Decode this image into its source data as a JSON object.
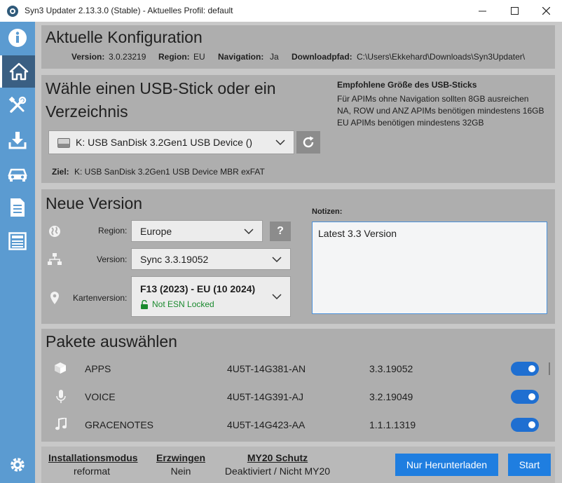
{
  "window": {
    "title": "Syn3 Updater 2.13.3.0 (Stable) - Aktuelles Profil: default",
    "minimize": "—",
    "maximize": "☐",
    "close": "✕"
  },
  "sidebar": {
    "items": [
      {
        "name": "info",
        "icon": "info-icon"
      },
      {
        "name": "home",
        "icon": "home-icon",
        "active": true
      },
      {
        "name": "tools",
        "icon": "tools-icon"
      },
      {
        "name": "download",
        "icon": "download-icon"
      },
      {
        "name": "car",
        "icon": "car-icon"
      },
      {
        "name": "log",
        "icon": "document-icon"
      },
      {
        "name": "news",
        "icon": "news-icon"
      },
      {
        "name": "settings",
        "icon": "gear-icon"
      }
    ]
  },
  "config": {
    "heading": "Aktuelle Konfiguration",
    "version_label": "Version:",
    "version_value": "3.0.23219",
    "region_label": "Region:",
    "region_value": "EU",
    "nav_label": "Navigation:",
    "nav_value": "Ja",
    "path_label": "Downloadpfad:",
    "path_value": "C:\\Users\\Ekkehard\\Downloads\\Syn3Updater\\"
  },
  "usb": {
    "heading_line1": "Wähle einen USB-Stick oder ein",
    "heading_line2": "Verzeichnis",
    "selected": "K:  USB  SanDisk 3.2Gen1 USB Device ()",
    "target_label": "Ziel:",
    "target_value": "K:  USB  SanDisk 3.2Gen1 USB Device  MBR exFAT",
    "recommend_title": "Empfohlene Größe des USB-Sticks",
    "recommend_lines": [
      "Für APIMs ohne Navigation sollten 8GB ausreichen",
      "NA, ROW und ANZ APIMs benötigen mindestens 16GB",
      "EU APIMs benötigen mindestens 32GB"
    ]
  },
  "new_version": {
    "heading": "Neue Version",
    "region_label": "Region:",
    "region_value": "Europe",
    "help_label": "?",
    "version_label": "Version:",
    "version_value": "Sync 3.3.19052",
    "map_label": "Kartenversion:",
    "map_value": "F13 (2023) - EU (10 2024)",
    "map_status": "Not ESN Locked",
    "notes_label": "Notizen:",
    "notes_value": "Latest 3.3 Version"
  },
  "packages": {
    "heading": "Pakete auswählen",
    "items": [
      {
        "name": "APPS",
        "part": "4U5T-14G381-AN",
        "version": "3.3.19052",
        "enabled": true,
        "icon": "package-icon"
      },
      {
        "name": "VOICE",
        "part": "4U5T-14G391-AJ",
        "version": "3.2.19049",
        "enabled": true,
        "icon": "microphone-icon"
      },
      {
        "name": "GRACENOTES",
        "part": "4U5T-14G423-AA",
        "version": "1.1.1.1319",
        "enabled": true,
        "icon": "music-note-icon"
      }
    ]
  },
  "footer": {
    "install_mode_label": "Installationsmodus",
    "install_mode_value": "reformat",
    "force_label": "Erzwingen",
    "force_value": "Nein",
    "my20_label": "MY20 Schutz",
    "my20_value": "Deaktiviert / Nicht MY20",
    "download_only_button": "Nur Herunterladen",
    "start_button": "Start"
  },
  "colors": {
    "sidebar": "#5b9bd1",
    "sidebar_active": "#3a5f83",
    "accent": "#1f7ee0",
    "success": "#1a8a2e"
  }
}
